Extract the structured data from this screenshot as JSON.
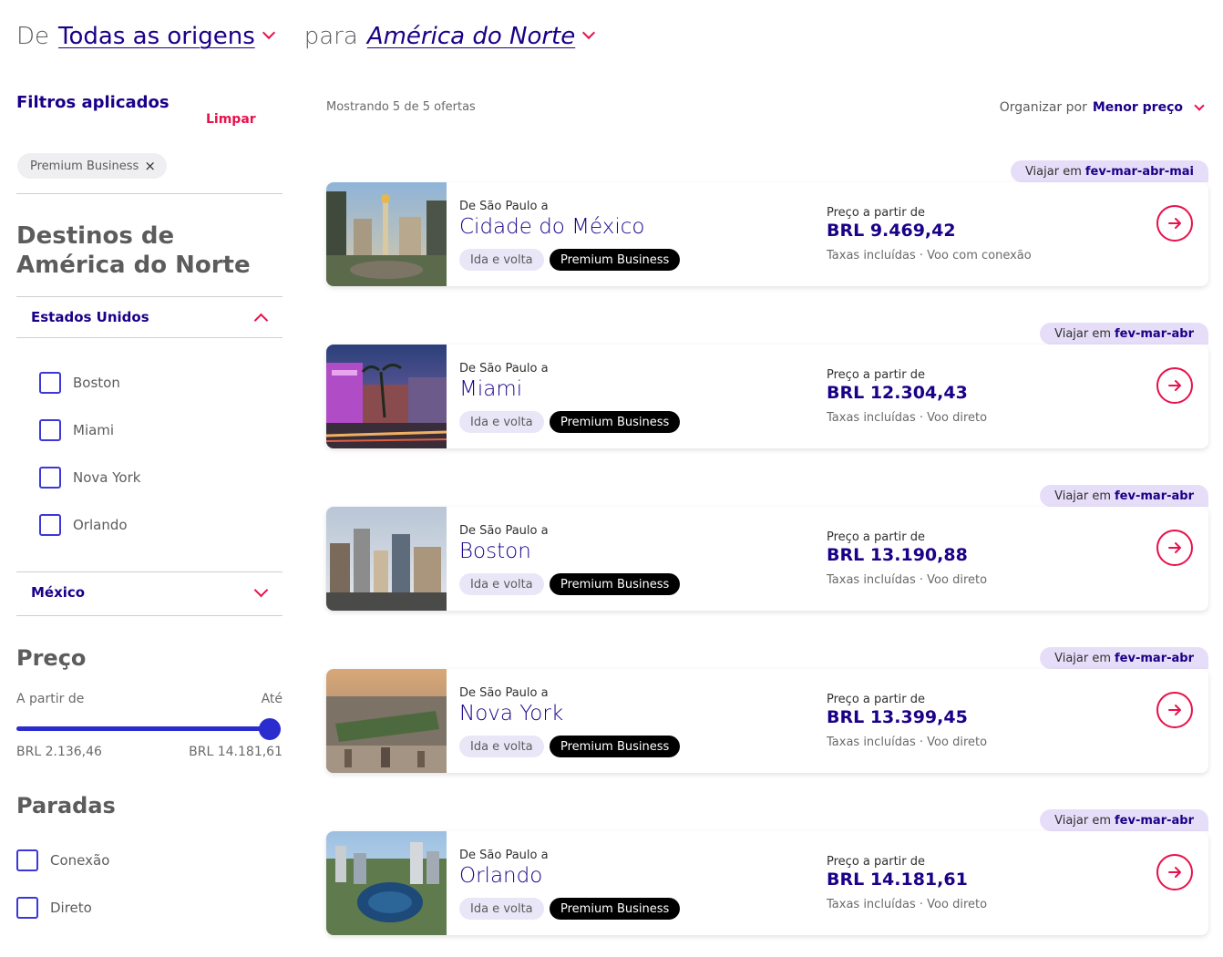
{
  "header": {
    "from_word": "De",
    "origin": "Todas as origens",
    "to_word": "para",
    "destination": "América do Norte"
  },
  "filters": {
    "title": "Filtros aplicados",
    "clear": "Limpar",
    "chip": "Premium Business",
    "destinations_title": "Destinos de América do Norte",
    "groups": [
      {
        "label": "Estados Unidos",
        "expanded": true,
        "cities": [
          "Boston",
          "Miami",
          "Nova York",
          "Orlando"
        ]
      },
      {
        "label": "México",
        "expanded": false
      }
    ],
    "price": {
      "title": "Preço",
      "from_label": "A partir de",
      "to_label": "Até",
      "min": "BRL 2.136,46",
      "max": "BRL 14.181,61"
    },
    "stops": {
      "title": "Paradas",
      "options": [
        "Conexão",
        "Direto"
      ]
    }
  },
  "results": {
    "showing": "Mostrando 5 de 5 ofertas",
    "sort_label": "Organizar por",
    "sort_value": "Menor preço"
  },
  "colors": {
    "brand": "#1b0088",
    "accent": "#e8114b",
    "checkbox": "#3b37d9",
    "tag": "#e6def8"
  },
  "offers": [
    {
      "travel_prefix": "Viajar em",
      "months": "fev-mar-abr-mai",
      "from": "De São Paulo a",
      "city": "Cidade do México",
      "trip": "Ida e volta",
      "cabin": "Premium Business",
      "price_from": "Preço a partir de",
      "price": "BRL 9.469,42",
      "note": "Taxas incluídas · Voo com conexão"
    },
    {
      "travel_prefix": "Viajar em",
      "months": "fev-mar-abr",
      "from": "De São Paulo a",
      "city": "Miami",
      "trip": "Ida e volta",
      "cabin": "Premium Business",
      "price_from": "Preço a partir de",
      "price": "BRL 12.304,43",
      "note": "Taxas incluídas · Voo direto"
    },
    {
      "travel_prefix": "Viajar em",
      "months": "fev-mar-abr",
      "from": "De São Paulo a",
      "city": "Boston",
      "trip": "Ida e volta",
      "cabin": "Premium Business",
      "price_from": "Preço a partir de",
      "price": "BRL 13.190,88",
      "note": "Taxas incluídas · Voo direto"
    },
    {
      "travel_prefix": "Viajar em",
      "months": "fev-mar-abr",
      "from": "De São Paulo a",
      "city": "Nova York",
      "trip": "Ida e volta",
      "cabin": "Premium Business",
      "price_from": "Preço a partir de",
      "price": "BRL 13.399,45",
      "note": "Taxas incluídas · Voo direto"
    },
    {
      "travel_prefix": "Viajar em",
      "months": "fev-mar-abr",
      "from": "De São Paulo a",
      "city": "Orlando",
      "trip": "Ida e volta",
      "cabin": "Premium Business",
      "price_from": "Preço a partir de",
      "price": "BRL 14.181,61",
      "note": "Taxas incluídas · Voo direto"
    }
  ]
}
